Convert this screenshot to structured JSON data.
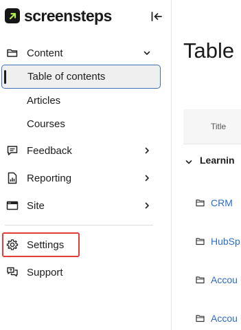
{
  "app": {
    "logo_text": "screensteps"
  },
  "sidebar": {
    "items": [
      {
        "label": "Content"
      },
      {
        "label": "Table of contents"
      },
      {
        "label": "Articles"
      },
      {
        "label": "Courses"
      },
      {
        "label": "Feedback"
      },
      {
        "label": "Reporting"
      },
      {
        "label": "Site"
      },
      {
        "label": "Settings"
      },
      {
        "label": "Support"
      }
    ]
  },
  "main": {
    "title": "Table c",
    "table": {
      "column_title": "Title",
      "group": "Learnin",
      "rows": [
        {
          "label": "CRM"
        },
        {
          "label": "HubSp"
        },
        {
          "label": "Accou"
        },
        {
          "label": "Accou"
        }
      ]
    }
  },
  "colors": {
    "accent": "#3f6fb5",
    "highlight": "#e33b36",
    "link": "#2d6cc4",
    "logo_arrow": "#b8f04a"
  },
  "icons": [
    "logo-icon",
    "collapse-sidebar-icon",
    "folder-icon",
    "chevron-down-icon",
    "feedback-icon",
    "reporting-icon",
    "site-icon",
    "chevron-right-icon",
    "gear-icon",
    "support-icon"
  ]
}
